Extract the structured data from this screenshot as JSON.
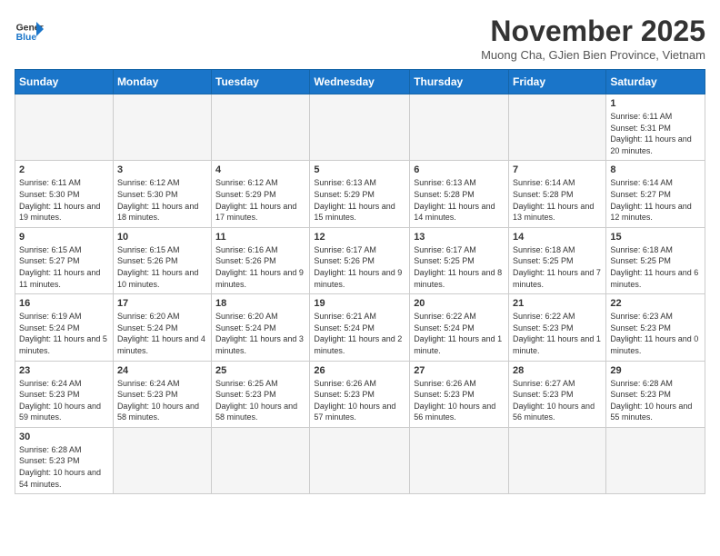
{
  "header": {
    "logo_general": "General",
    "logo_blue": "Blue",
    "month_title": "November 2025",
    "subtitle": "Muong Cha, GJien Bien Province, Vietnam"
  },
  "weekdays": [
    "Sunday",
    "Monday",
    "Tuesday",
    "Wednesday",
    "Thursday",
    "Friday",
    "Saturday"
  ],
  "days": [
    {
      "date": "",
      "info": ""
    },
    {
      "date": "",
      "info": ""
    },
    {
      "date": "",
      "info": ""
    },
    {
      "date": "",
      "info": ""
    },
    {
      "date": "",
      "info": ""
    },
    {
      "date": "",
      "info": ""
    },
    {
      "date": "1",
      "info": "Sunrise: 6:11 AM\nSunset: 5:31 PM\nDaylight: 11 hours and 20 minutes."
    },
    {
      "date": "2",
      "info": "Sunrise: 6:11 AM\nSunset: 5:30 PM\nDaylight: 11 hours and 19 minutes."
    },
    {
      "date": "3",
      "info": "Sunrise: 6:12 AM\nSunset: 5:30 PM\nDaylight: 11 hours and 18 minutes."
    },
    {
      "date": "4",
      "info": "Sunrise: 6:12 AM\nSunset: 5:29 PM\nDaylight: 11 hours and 17 minutes."
    },
    {
      "date": "5",
      "info": "Sunrise: 6:13 AM\nSunset: 5:29 PM\nDaylight: 11 hours and 15 minutes."
    },
    {
      "date": "6",
      "info": "Sunrise: 6:13 AM\nSunset: 5:28 PM\nDaylight: 11 hours and 14 minutes."
    },
    {
      "date": "7",
      "info": "Sunrise: 6:14 AM\nSunset: 5:28 PM\nDaylight: 11 hours and 13 minutes."
    },
    {
      "date": "8",
      "info": "Sunrise: 6:14 AM\nSunset: 5:27 PM\nDaylight: 11 hours and 12 minutes."
    },
    {
      "date": "9",
      "info": "Sunrise: 6:15 AM\nSunset: 5:27 PM\nDaylight: 11 hours and 11 minutes."
    },
    {
      "date": "10",
      "info": "Sunrise: 6:15 AM\nSunset: 5:26 PM\nDaylight: 11 hours and 10 minutes."
    },
    {
      "date": "11",
      "info": "Sunrise: 6:16 AM\nSunset: 5:26 PM\nDaylight: 11 hours and 9 minutes."
    },
    {
      "date": "12",
      "info": "Sunrise: 6:17 AM\nSunset: 5:26 PM\nDaylight: 11 hours and 9 minutes."
    },
    {
      "date": "13",
      "info": "Sunrise: 6:17 AM\nSunset: 5:25 PM\nDaylight: 11 hours and 8 minutes."
    },
    {
      "date": "14",
      "info": "Sunrise: 6:18 AM\nSunset: 5:25 PM\nDaylight: 11 hours and 7 minutes."
    },
    {
      "date": "15",
      "info": "Sunrise: 6:18 AM\nSunset: 5:25 PM\nDaylight: 11 hours and 6 minutes."
    },
    {
      "date": "16",
      "info": "Sunrise: 6:19 AM\nSunset: 5:24 PM\nDaylight: 11 hours and 5 minutes."
    },
    {
      "date": "17",
      "info": "Sunrise: 6:20 AM\nSunset: 5:24 PM\nDaylight: 11 hours and 4 minutes."
    },
    {
      "date": "18",
      "info": "Sunrise: 6:20 AM\nSunset: 5:24 PM\nDaylight: 11 hours and 3 minutes."
    },
    {
      "date": "19",
      "info": "Sunrise: 6:21 AM\nSunset: 5:24 PM\nDaylight: 11 hours and 2 minutes."
    },
    {
      "date": "20",
      "info": "Sunrise: 6:22 AM\nSunset: 5:24 PM\nDaylight: 11 hours and 1 minute."
    },
    {
      "date": "21",
      "info": "Sunrise: 6:22 AM\nSunset: 5:23 PM\nDaylight: 11 hours and 1 minute."
    },
    {
      "date": "22",
      "info": "Sunrise: 6:23 AM\nSunset: 5:23 PM\nDaylight: 11 hours and 0 minutes."
    },
    {
      "date": "23",
      "info": "Sunrise: 6:24 AM\nSunset: 5:23 PM\nDaylight: 10 hours and 59 minutes."
    },
    {
      "date": "24",
      "info": "Sunrise: 6:24 AM\nSunset: 5:23 PM\nDaylight: 10 hours and 58 minutes."
    },
    {
      "date": "25",
      "info": "Sunrise: 6:25 AM\nSunset: 5:23 PM\nDaylight: 10 hours and 58 minutes."
    },
    {
      "date": "26",
      "info": "Sunrise: 6:26 AM\nSunset: 5:23 PM\nDaylight: 10 hours and 57 minutes."
    },
    {
      "date": "27",
      "info": "Sunrise: 6:26 AM\nSunset: 5:23 PM\nDaylight: 10 hours and 56 minutes."
    },
    {
      "date": "28",
      "info": "Sunrise: 6:27 AM\nSunset: 5:23 PM\nDaylight: 10 hours and 56 minutes."
    },
    {
      "date": "29",
      "info": "Sunrise: 6:28 AM\nSunset: 5:23 PM\nDaylight: 10 hours and 55 minutes."
    },
    {
      "date": "30",
      "info": "Sunrise: 6:28 AM\nSunset: 5:23 PM\nDaylight: 10 hours and 54 minutes."
    },
    {
      "date": "",
      "info": ""
    },
    {
      "date": "",
      "info": ""
    },
    {
      "date": "",
      "info": ""
    },
    {
      "date": "",
      "info": ""
    },
    {
      "date": "",
      "info": ""
    },
    {
      "date": "",
      "info": ""
    }
  ]
}
